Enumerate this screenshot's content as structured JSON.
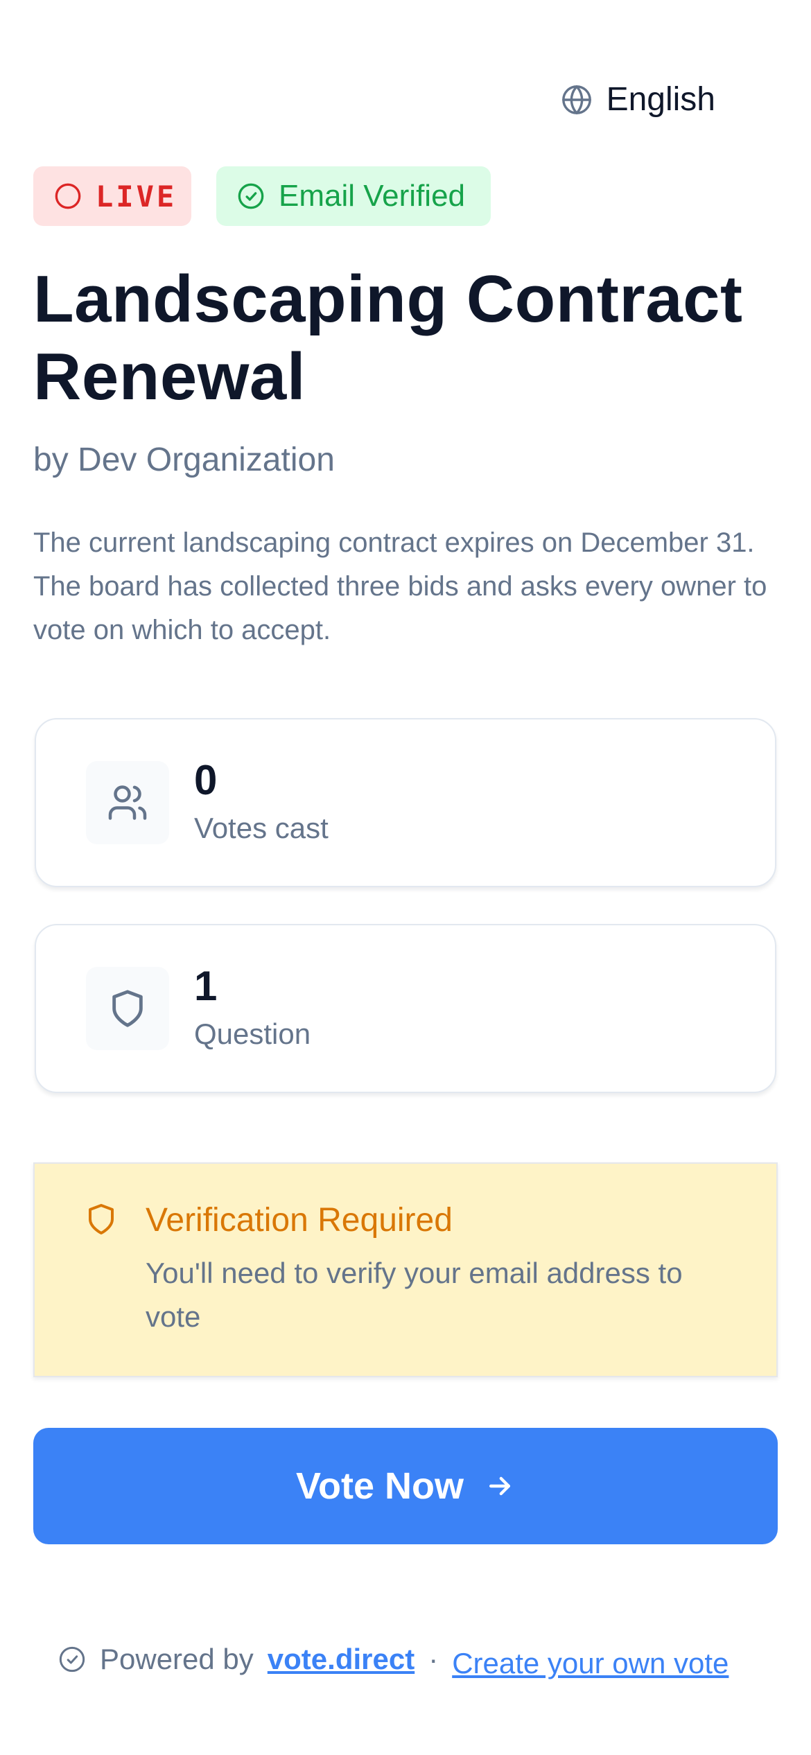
{
  "language": {
    "label": "English",
    "icon": "globe-icon"
  },
  "badges": {
    "live": {
      "label": "LIVE",
      "icon": "circle-icon",
      "color": "#dc2626",
      "bg": "#fee2e2"
    },
    "verified": {
      "label": "Email Verified",
      "icon": "check-circle-icon",
      "color": "#16a34a",
      "bg": "#dcfce7"
    }
  },
  "vote": {
    "title": "Landscaping Contract Renewal",
    "organization": "by Dev Organization",
    "description": "The current landscaping contract expires on December 31. The board has collected three bids and asks every owner to vote on which to accept."
  },
  "stats": [
    {
      "value": "0",
      "label": "Votes cast",
      "icon": "users-icon"
    },
    {
      "value": "1",
      "label": "Question",
      "icon": "shield-icon"
    }
  ],
  "verification": {
    "title": "Verification Required",
    "message": "You'll need to verify your email address to vote",
    "icon": "shield-icon",
    "color": "#d97706",
    "bg": "#fef3c7"
  },
  "cta": {
    "label": "Vote Now",
    "icon": "arrow-right-icon",
    "color": "#3b82f6"
  },
  "footer": {
    "powered_by": "Powered by",
    "brand": "vote.direct",
    "separator": "·",
    "create_link": "Create your own vote",
    "icon": "check-circle-icon"
  }
}
